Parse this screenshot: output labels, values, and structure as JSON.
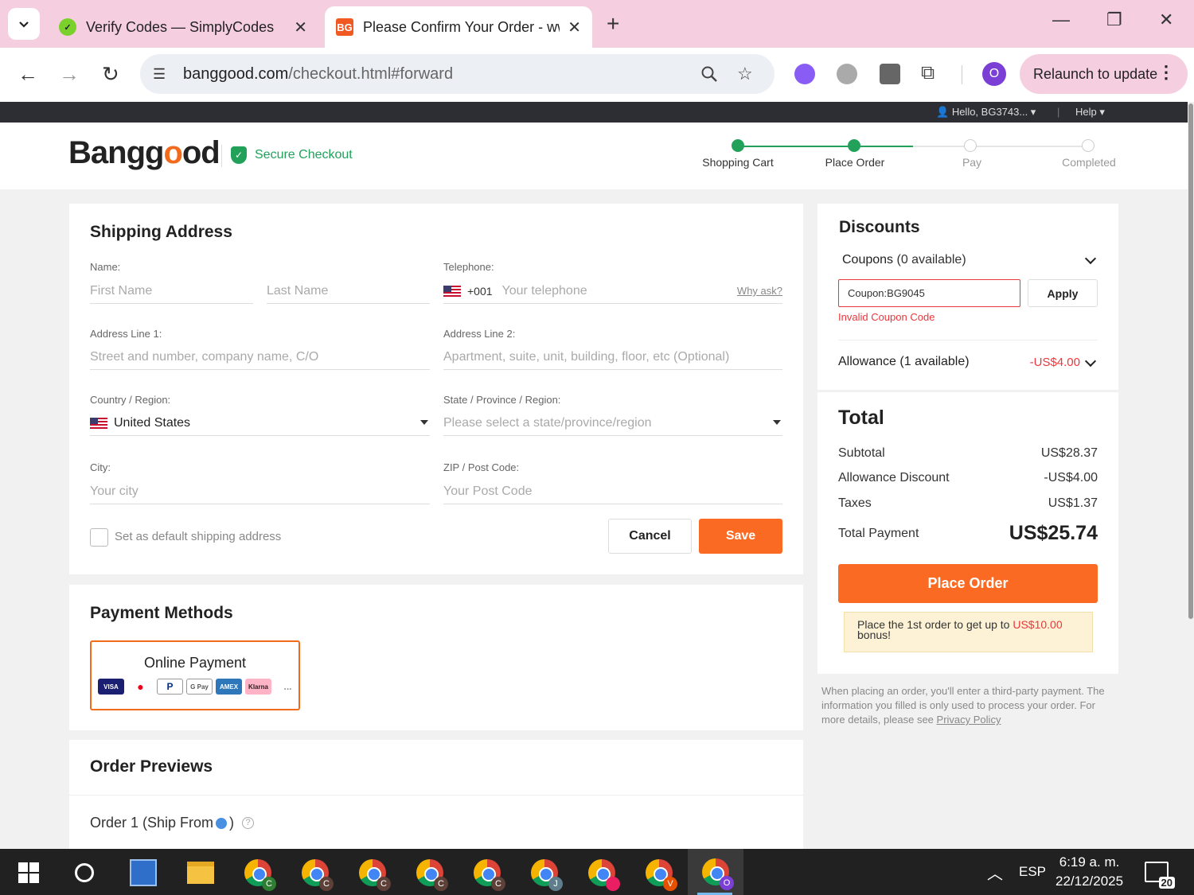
{
  "browser": {
    "tabs": [
      {
        "title": "Verify Codes — SimplyCodes",
        "favicon": "simplycodes-icon"
      },
      {
        "title": "Please Confirm Your Order - ww",
        "favicon_text": "BG"
      }
    ],
    "url_host": "banggood.com",
    "url_path": "/checkout.html#forward",
    "profile_initial": "O",
    "relaunch_label": "Relaunch to update"
  },
  "site": {
    "hello": "Hello, BG3743... ▾",
    "help": "Help ▾",
    "logo_a": "Bangg",
    "logo_b": "o",
    "logo_c": "od",
    "secure": "Secure Checkout",
    "steps": [
      "Shopping Cart",
      "Place Order",
      "Pay",
      "Completed"
    ]
  },
  "shipping": {
    "title": "Shipping Address",
    "name_label": "Name:",
    "first_name_ph": "First Name",
    "last_name_ph": "Last Name",
    "tel_label": "Telephone:",
    "tel_code": "+001",
    "tel_ph": "Your telephone",
    "why_ask": "Why ask?",
    "addr1_label": "Address Line 1:",
    "addr1_ph": "Street and number, company name, C/O",
    "addr2_label": "Address Line 2:",
    "addr2_ph": "Apartment, suite, unit, building, floor, etc (Optional)",
    "country_label": "Country / Region:",
    "country_value": "United States",
    "state_label": "State / Province / Region:",
    "state_ph": "Please select a state/province/region",
    "city_label": "City:",
    "city_ph": "Your city",
    "zip_label": "ZIP / Post Code:",
    "zip_ph": "Your Post Code",
    "default_label": "Set as default shipping address",
    "cancel": "Cancel",
    "save": "Save"
  },
  "payment": {
    "title": "Payment Methods",
    "online": "Online Payment",
    "logos": [
      "VISA",
      "MC",
      "PayPal",
      "G Pay",
      "AMEX",
      "Klarna",
      "..."
    ]
  },
  "orders": {
    "title": "Order Previews",
    "order1": "Order 1 (Ship From",
    "order1_end": ")"
  },
  "discounts": {
    "title": "Discounts",
    "coupons": "Coupons",
    "coupons_count": "(0 available)",
    "coupon_value": "Coupon:BG9045",
    "apply": "Apply",
    "invalid": "Invalid Coupon Code",
    "allowance": "Allowance",
    "allowance_count": "(1 available)",
    "allowance_value": "-US$4.00"
  },
  "totals": {
    "title": "Total",
    "subtotal_label": "Subtotal",
    "subtotal": "US$28.37",
    "allowance_label": "Allowance Discount",
    "allowance": "-US$4.00",
    "taxes_label": "Taxes",
    "taxes": "US$1.37",
    "total_label": "Total Payment",
    "total": "US$25.74",
    "place_order": "Place Order",
    "bonus_a": "Place the 1st order to get up to ",
    "bonus_amount": "US$10.00",
    "bonus_b": "bonus!"
  },
  "notice": {
    "text": "When placing an order, you'll enter a third-party payment. The information you filled is only used to process your order. For more details, please see ",
    "link": "Privacy Policy"
  },
  "taskbar": {
    "badges": [
      "C",
      "C",
      "C",
      "C",
      "C",
      "J",
      "",
      "V",
      "O"
    ],
    "lang": "ESP",
    "time": "6:19 a. m.",
    "date": "22/12/2025",
    "notif_count": "20"
  },
  "colors": {
    "accent": "#fb6a22",
    "secure_green": "#21a15a",
    "error_red": "#e8383d"
  }
}
